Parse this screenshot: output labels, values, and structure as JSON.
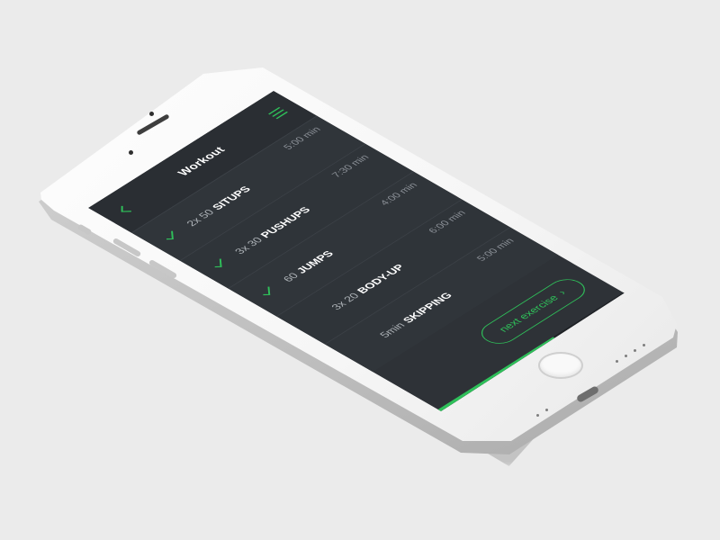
{
  "app": {
    "title": "Workout",
    "accent_color": "#2fc05a",
    "background_color": "#2e3237"
  },
  "header": {
    "back_icon": "chevron-left-icon",
    "menu_icon": "hamburger-menu-icon"
  },
  "exercises": [
    {
      "reps": "2x 50",
      "name": "SITUPS",
      "duration": "5:00 min",
      "completed": true
    },
    {
      "reps": "3x 30",
      "name": "PUSHUPS",
      "duration": "7:30 min",
      "completed": true
    },
    {
      "reps": "60",
      "name": "JUMPS",
      "duration": "4:00 min",
      "completed": true
    },
    {
      "reps": "3x 20",
      "name": "BODY-UP",
      "duration": "6:00 min",
      "completed": false
    },
    {
      "reps": "5min",
      "name": "SKIPPING",
      "duration": "5:00 min",
      "completed": false
    }
  ],
  "actions": {
    "next_label": "next exercise",
    "next_icon": "chevron-right-icon"
  },
  "progress": {
    "fraction": 0.62
  }
}
